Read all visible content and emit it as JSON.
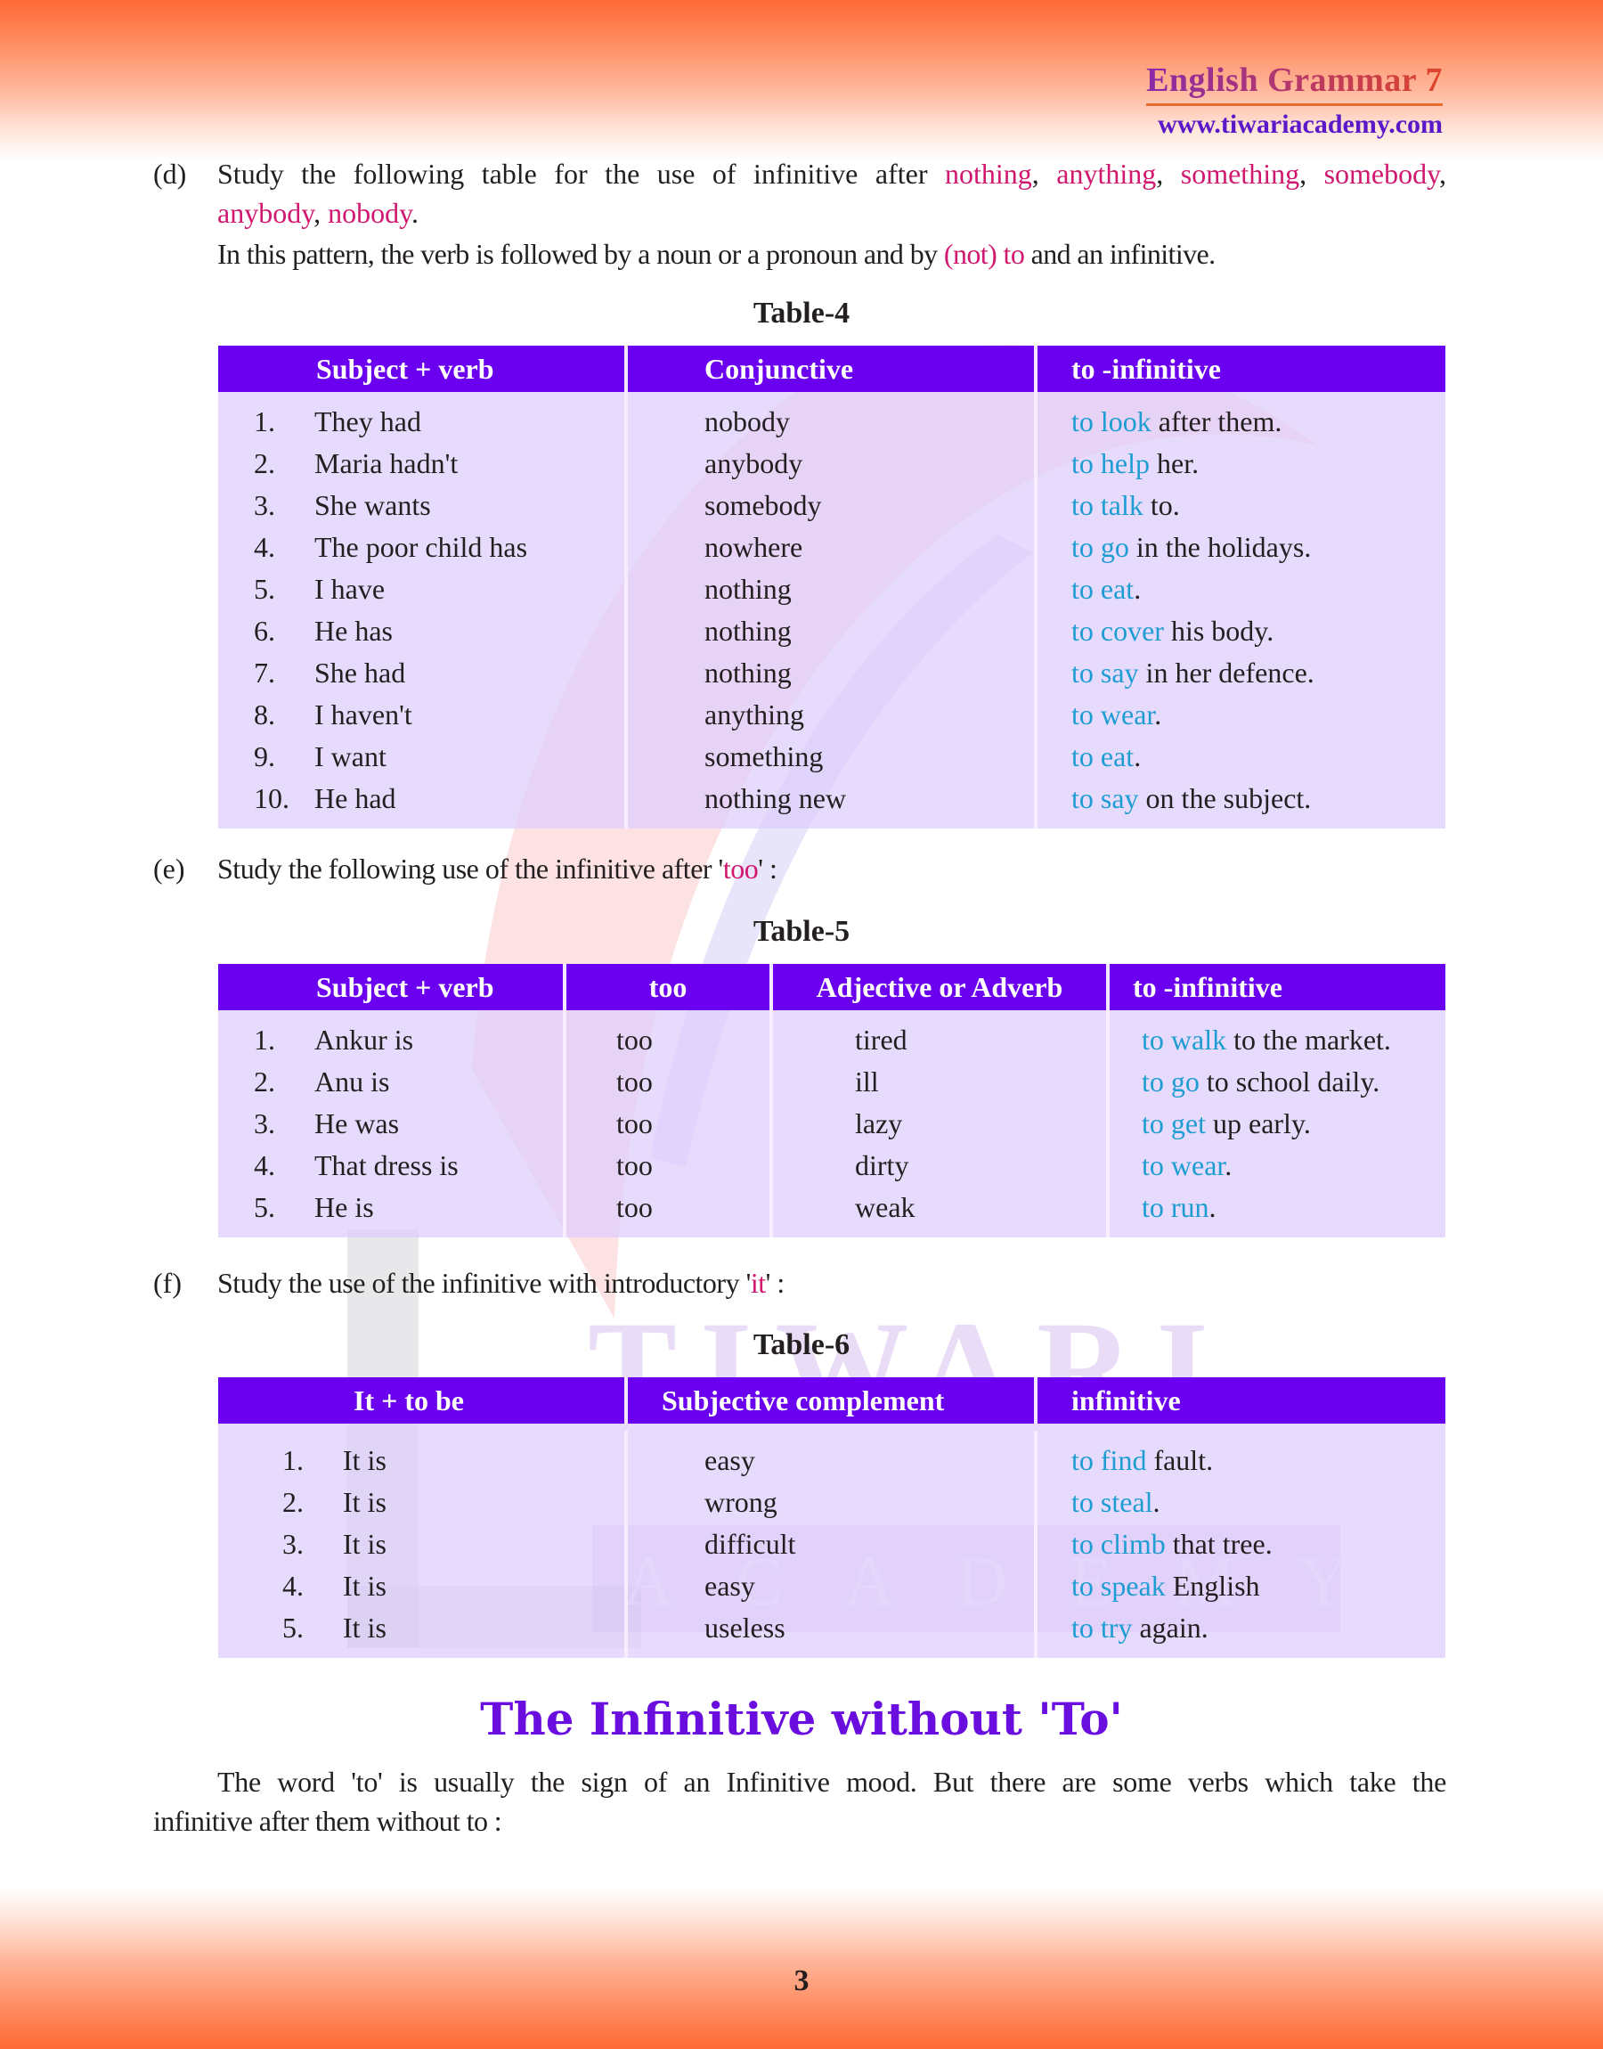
{
  "header": {
    "book_title": "English Grammar 7",
    "website": "www.tiwariacademy.com"
  },
  "watermark": {
    "top_text": "TIWARI",
    "bottom_text": "ACADEMY"
  },
  "section_d": {
    "marker": "(d)",
    "intro_prefix": "Study the following table for the use of infinitive after",
    "highlight_words": [
      "nothing",
      "anything",
      "something",
      "somebody",
      "anybody",
      "nobody"
    ],
    "pattern_prefix": "In this pattern, the verb is followed by a noun or a pronoun and by",
    "pattern_highlight": "(not) to",
    "pattern_suffix": "and an infinitive."
  },
  "table4": {
    "caption": "Table-4",
    "headers": [
      "Subject + verb",
      "Conjunctive",
      "to -infinitive"
    ],
    "rows": [
      {
        "num": "1.",
        "subject": "They had",
        "middle": "nobody",
        "inf": "to look",
        "rest": "after them."
      },
      {
        "num": "2.",
        "subject": "Maria hadn't",
        "middle": "anybody",
        "inf": "to help",
        "rest": "her."
      },
      {
        "num": "3.",
        "subject": "She wants",
        "middle": "somebody",
        "inf": "to talk",
        "rest": "to."
      },
      {
        "num": "4.",
        "subject": "The poor child has",
        "middle": "nowhere",
        "inf": "to go",
        "rest": "in the holidays."
      },
      {
        "num": "5.",
        "subject": "I have",
        "middle": "nothing",
        "inf": "to eat",
        "rest": "."
      },
      {
        "num": "6.",
        "subject": "He has",
        "middle": "nothing",
        "inf": "to cover",
        "rest": "his body."
      },
      {
        "num": "7.",
        "subject": "She had",
        "middle": "nothing",
        "inf": "to say",
        "rest": "in her defence."
      },
      {
        "num": "8.",
        "subject": "I haven't",
        "middle": "anything",
        "inf": "to wear",
        "rest": "."
      },
      {
        "num": "9.",
        "subject": "I want",
        "middle": "something",
        "inf": "to eat",
        "rest": "."
      },
      {
        "num": "10.",
        "subject": "He had",
        "middle": "nothing new",
        "inf": "to say",
        "rest": "on the subject."
      }
    ]
  },
  "section_e": {
    "marker": "(e)",
    "text_prefix": "Study the following use of the infinitive after '",
    "highlight": "too",
    "text_suffix": "' :"
  },
  "table5": {
    "caption": "Table-5",
    "headers": [
      "Subject + verb",
      "too",
      "Adjective or Adverb",
      "to -infinitive"
    ],
    "rows": [
      {
        "num": "1.",
        "subject": "Ankur is",
        "too": "too",
        "adj": "tired",
        "inf": "to walk",
        "rest": "to the market."
      },
      {
        "num": "2.",
        "subject": "Anu is",
        "too": "too",
        "adj": "ill",
        "inf": "to go",
        "rest": "to school daily."
      },
      {
        "num": "3.",
        "subject": "He was",
        "too": "too",
        "adj": "lazy",
        "inf": "to get",
        "rest": "up early."
      },
      {
        "num": "4.",
        "subject": "That dress is",
        "too": "too",
        "adj": "dirty",
        "inf": "to wear",
        "rest": "."
      },
      {
        "num": "5.",
        "subject": "He is",
        "too": "too",
        "adj": "weak",
        "inf": "to run",
        "rest": "."
      }
    ]
  },
  "section_f": {
    "marker": "(f)",
    "text_prefix": "Study the use of the infinitive with introductory '",
    "highlight": "it",
    "text_suffix": "' :"
  },
  "table6": {
    "caption": "Table-6",
    "headers": [
      "It + to be",
      "Subjective complement",
      "infinitive"
    ],
    "rows": [
      {
        "num": "1.",
        "subject": "It is",
        "middle": "easy",
        "inf": "to find",
        "rest": "fault."
      },
      {
        "num": "2.",
        "subject": "It is",
        "middle": "wrong",
        "inf": "to steal",
        "rest": "."
      },
      {
        "num": "3.",
        "subject": "It is",
        "middle": "difficult",
        "inf": "to climb",
        "rest": "that tree."
      },
      {
        "num": "4.",
        "subject": "It is",
        "middle": "easy",
        "inf": "to speak",
        "rest": "English"
      },
      {
        "num": "5.",
        "subject": "It is",
        "middle": "useless",
        "inf": "to try",
        "rest": "again."
      }
    ]
  },
  "section_heading": "The Infinitive without 'To'",
  "closing_paragraph": {
    "line1": "The word 'to' is usually the sign of an Infinitive mood. But there are some verbs which take the",
    "line2": "infinitive after them without to :"
  },
  "page_number": "3",
  "colors": {
    "header_band": "#ff6a36",
    "table_header": "#6a00ef",
    "table_body": "#e6d9fc",
    "highlight_magenta": "#d0186f",
    "infinitive_blue": "#1e9dd2",
    "heading_purple": "#6a0ee0",
    "website_blue": "#5a18c8"
  }
}
